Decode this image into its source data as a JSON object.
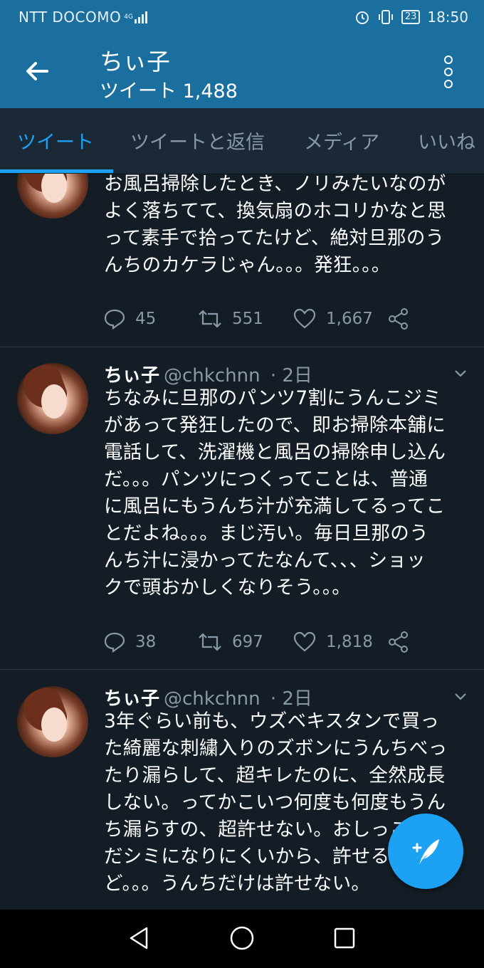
{
  "status": {
    "carrier": "NTT DOCOMO",
    "network": "4G",
    "battery": "23",
    "time": "18:50"
  },
  "header": {
    "title": "ちぃ子",
    "subtitle": "ツイート 1,488",
    "back_icon": "arrow-left-icon",
    "menu_icon": "more-vertical-icon"
  },
  "tabs": [
    {
      "label": "ツイート",
      "active": true
    },
    {
      "label": "ツイートと返信",
      "active": false
    },
    {
      "label": "メディア",
      "active": false
    },
    {
      "label": "いいね",
      "active": false
    }
  ],
  "tweets": [
    {
      "name": "",
      "handle": "",
      "time": "",
      "text": "お風呂掃除したとき、ノリみたいなのが\nよく落ちてて、換気扇のホコリかなと思\nって素手で拾ってたけど、絶対旦那のう\nんちのカケラじゃん。。。発狂。。。",
      "replies": "45",
      "retweets": "551",
      "likes": "1,667"
    },
    {
      "name": "ちぃ子",
      "handle": "@chkchnn",
      "time": "· 2日",
      "text": "ちなみに旦那のパンツ7割にうんこジミ\nがあって発狂したので、即お掃除本舗に\n電話して、洗濯機と風呂の掃除申し込ん\nだ。。。パンツにつくってことは、普通\nに風呂にもうんち汁が充満してるってこ\nとだよね。。。まじ汚い。毎日旦那のう\nんち汁に浸かってたなんて、、、ショッ\nクで頭おかしくなりそう。。。",
      "replies": "38",
      "retweets": "697",
      "likes": "1,818"
    },
    {
      "name": "ちぃ子",
      "handle": "@chkchnn",
      "time": "· 2日",
      "text": "3年ぐらい前も、ウズベキスタンで買っ\nた綺麗な刺繍入りのズボンにうんちべっ\nたり漏らして、超キレたのに、全然成長\nしない。ってかこいつ何度も何度もうん\nち漏らすの、超許せない。おしっこはま\nだシミになりにくいから、許せるけ\nど。。。うんちだけは許せない。"
    }
  ],
  "fab_icon": "compose-tweet-icon",
  "colors": {
    "statusbar": "#1b6f9e",
    "background": "#141d26",
    "tabs": "#1b2836",
    "accent": "#1da1f2",
    "muted": "#8899a6"
  }
}
